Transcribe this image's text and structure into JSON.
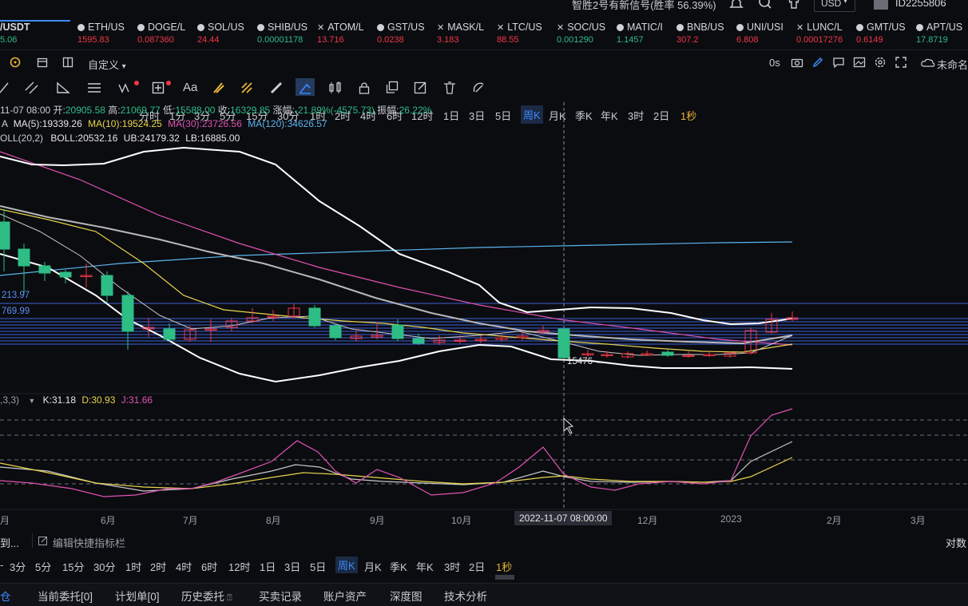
{
  "header": {
    "signal_text": "智胜2号有新信号(胜率 56.39%)",
    "currency": "USD",
    "user_id": "ID2255806"
  },
  "tickers": [
    {
      "name": "/USDT",
      "price": "5.06",
      "color": "#2ebd85",
      "icon": "none"
    },
    {
      "name": "ETH/US",
      "price": "1595.83",
      "color": "#f23645",
      "icon": "dot"
    },
    {
      "name": "DOGE/L",
      "price": "0.087360",
      "color": "#f23645",
      "icon": "dot"
    },
    {
      "name": "SOL/US",
      "price": "24.44",
      "color": "#f23645",
      "icon": "dot"
    },
    {
      "name": "SHIB/US",
      "price": "0.00001178",
      "color": "#2ebd85",
      "icon": "dot"
    },
    {
      "name": "ATOM/L",
      "price": "13.716",
      "color": "#f23645",
      "icon": "x"
    },
    {
      "name": "GST/US",
      "price": "0.0238",
      "color": "#f23645",
      "icon": "dot"
    },
    {
      "name": "MASK/L",
      "price": "3.183",
      "color": "#f23645",
      "icon": "x"
    },
    {
      "name": "LTC/US",
      "price": "88.55",
      "color": "#f23645",
      "icon": "x"
    },
    {
      "name": "SOC/US",
      "price": "0.001290",
      "color": "#2ebd85",
      "icon": "x"
    },
    {
      "name": "MATIC/I",
      "price": "1.1457",
      "color": "#2ebd85",
      "icon": "dot"
    },
    {
      "name": "BNB/US",
      "price": "307.2",
      "color": "#f23645",
      "icon": "dot"
    },
    {
      "name": "UNI/USI",
      "price": "6.808",
      "color": "#f23645",
      "icon": "dot"
    },
    {
      "name": "LUNC/L",
      "price": "0.00017276",
      "color": "#f23645",
      "icon": "x"
    },
    {
      "name": "GMT/US",
      "price": "0.6149",
      "color": "#f23645",
      "icon": "dot"
    },
    {
      "name": "APT/US",
      "price": "17.8719",
      "color": "#2ebd85",
      "icon": "dot"
    }
  ],
  "toolbar": {
    "custom": "自定义",
    "timeframes": [
      "分时",
      "1分",
      "3分",
      "5分",
      "15分",
      "30分",
      "1时",
      "2时",
      "4时",
      "6时",
      "12时",
      "1日",
      "3日",
      "5日",
      "周K",
      "月K",
      "季K",
      "年K",
      "3时",
      "2日",
      "1秒"
    ],
    "active": "周K",
    "countdown": "0s",
    "unnamed": "未命名"
  },
  "drawing_tools": {
    "text_tool": "Aa"
  },
  "ohlc": {
    "date": "11-07 08:00",
    "open_label": "开:",
    "open": "20905.58",
    "high_label": "高:",
    "high": "21069.77",
    "low_label": "低:",
    "low": "15588.00",
    "close_label": "收:",
    "close": "16329.85",
    "change_label": "涨幅:",
    "change": "-21.89%(-4575.73)",
    "amp_label": "振幅:",
    "amp": "26.22%"
  },
  "ma": {
    "ma5": "MA(5):19339.26",
    "ma10": "MA(10):19524.25",
    "ma30": "MA(30):23726.56",
    "ma120": "MA(120):34626.57"
  },
  "boll": {
    "label": "OLL(20,2)",
    "mid": "BOLL:20532.16",
    "ub": "UB:24179.32",
    "lb": "LB:16885.00"
  },
  "price_labels": {
    "level1": "213.97",
    "level2": "769.99",
    "low_marker": "15476 →"
  },
  "kdj": {
    "params": ",3,3)",
    "k": "K:31.18",
    "d": "D:30.93",
    "j": "J:31.66"
  },
  "x_axis": {
    "labels": [
      "月",
      "6月",
      "7月",
      "8月",
      "9月",
      "10月",
      "12月",
      "2023",
      "2月",
      "3月"
    ],
    "crosshair": "2022-11-07 08:00:00"
  },
  "bottom": {
    "left_text": "到...",
    "edit_indicators": "编辑快捷指标栏",
    "log": "对数",
    "timeframes": [
      "3分",
      "5分",
      "15分",
      "30分",
      "1时",
      "2时",
      "4时",
      "6时",
      "12时",
      "1日",
      "3日",
      "5日",
      "周K",
      "月K",
      "季K",
      "年K",
      "3时",
      "2日",
      "1秒"
    ]
  },
  "tabs": [
    "仓",
    "当前委托[0]",
    "计划单[0]",
    "历史委托",
    "买卖记录",
    "账户资产",
    "深度图",
    "技术分析"
  ],
  "colors": {
    "up": "#2ebd85",
    "down": "#f23645",
    "accent": "#3d8bfd",
    "gold": "#e8b43a"
  }
}
